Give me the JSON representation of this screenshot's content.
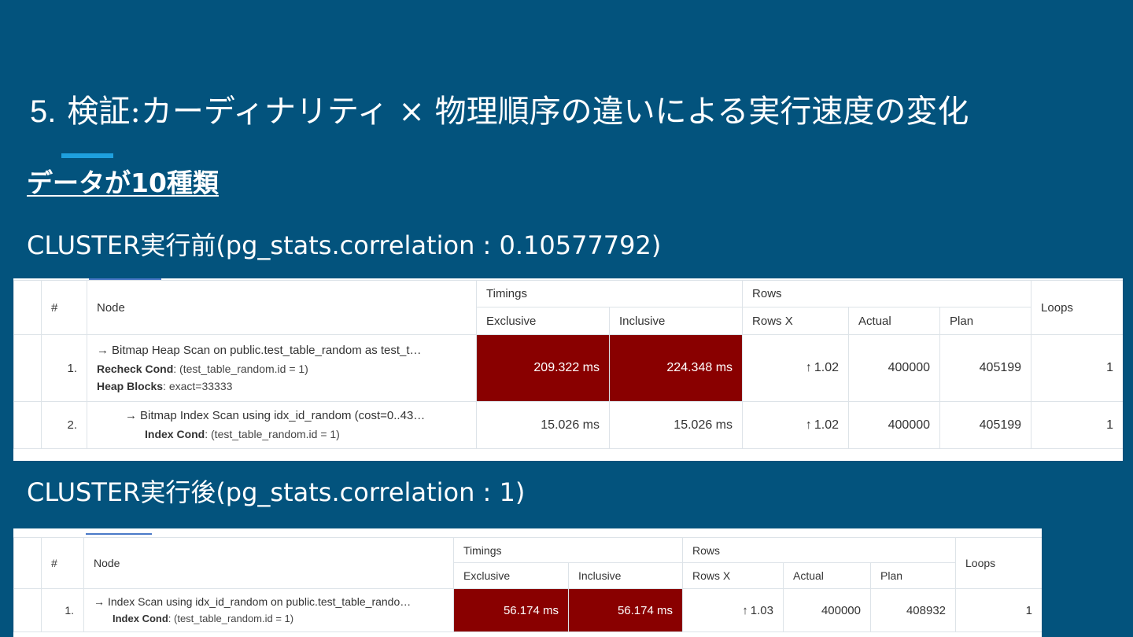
{
  "slide": {
    "number": "5.",
    "title": "検証:カーディナリティ × 物理順序の違いによる実行速度の変化",
    "subtitle": "データが10種類"
  },
  "before": {
    "label": "CLUSTER実行前(pg_stats.correlation : 0.10577792)",
    "headers": {
      "hash": "#",
      "node": "Node",
      "timings": "Timings",
      "rows": "Rows",
      "loops": "Loops",
      "exclusive": "Exclusive",
      "inclusive": "Inclusive",
      "rows_x": "Rows X",
      "actual": "Actual",
      "plan": "Plan"
    },
    "rows": [
      {
        "num": "1.",
        "node_title": "Bitmap Heap Scan on public.test_table_random as test_t…",
        "details": [
          {
            "key": "Recheck Cond",
            "value": ": (test_table_random.id = 1)"
          },
          {
            "key": "Heap Blocks",
            "value": ": exact=33333"
          }
        ],
        "exclusive": "209.322 ms",
        "inclusive": "224.348 ms",
        "rows_x": "1.02",
        "actual": "400000",
        "plan": "405199",
        "loops": "1"
      },
      {
        "num": "2.",
        "node_title": "Bitmap Index Scan using idx_id_random (cost=0..43…",
        "details": [
          {
            "key": "Index Cond",
            "value": ": (test_table_random.id = 1)"
          }
        ],
        "exclusive": "15.026 ms",
        "inclusive": "15.026 ms",
        "rows_x": "1.02",
        "actual": "400000",
        "plan": "405199",
        "loops": "1"
      }
    ]
  },
  "after": {
    "label": "CLUSTER実行後(pg_stats.correlation : 1)",
    "headers": {
      "hash": "#",
      "node": "Node",
      "timings": "Timings",
      "rows": "Rows",
      "loops": "Loops",
      "exclusive": "Exclusive",
      "inclusive": "Inclusive",
      "rows_x": "Rows X",
      "actual": "Actual",
      "plan": "Plan"
    },
    "rows": [
      {
        "num": "1.",
        "node_title": "Index Scan using idx_id_random on public.test_table_rando…",
        "details": [
          {
            "key": "Index Cond",
            "value": ": (test_table_random.id = 1)"
          }
        ],
        "exclusive": "56.174 ms",
        "inclusive": "56.174 ms",
        "rows_x": "1.03",
        "actual": "400000",
        "plan": "408932",
        "loops": "1"
      }
    ]
  },
  "colors": {
    "background": "#03537d",
    "accent_bar": "#1ea0de",
    "hot_cell": "#890000"
  },
  "icons": {
    "node_arrow": "→",
    "rows_up": "↑"
  }
}
